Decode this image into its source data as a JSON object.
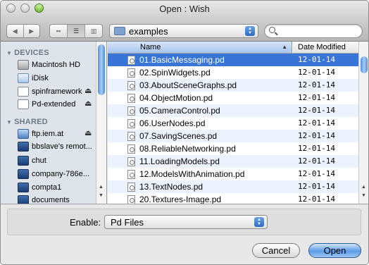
{
  "window": {
    "title": "Open : Wish"
  },
  "toolbar": {
    "back_glyph": "◀",
    "forward_glyph": "▶",
    "view_icons_glyph": "▪▪",
    "view_list_glyph": "☰",
    "view_columns_glyph": "▥",
    "path_folder": "examples",
    "search_placeholder": ""
  },
  "sidebar": {
    "devices_header": "DEVICES",
    "shared_header": "SHARED",
    "devices": [
      {
        "label": "Macintosh HD",
        "icon": "hard-drive-icon",
        "eject": ""
      },
      {
        "label": "iDisk",
        "icon": "idisk-icon",
        "eject": ""
      },
      {
        "label": "spinframework",
        "icon": "disk-image-icon",
        "eject": "⏏"
      },
      {
        "label": "Pd-extended",
        "icon": "disk-image-icon",
        "eject": "⏏"
      }
    ],
    "shared": [
      {
        "label": "ftp.iem.at",
        "icon": "network-server-icon",
        "eject": "⏏"
      },
      {
        "label": "bbslave's remot...",
        "icon": "monitor-icon",
        "eject": ""
      },
      {
        "label": "chut",
        "icon": "monitor-icon",
        "eject": ""
      },
      {
        "label": "company-786e...",
        "icon": "monitor-icon",
        "eject": ""
      },
      {
        "label": "compta1",
        "icon": "monitor-icon",
        "eject": ""
      },
      {
        "label": "documents",
        "icon": "monitor-icon",
        "eject": ""
      }
    ]
  },
  "filelist": {
    "col_name": "Name",
    "col_date": "Date Modified",
    "sort_glyph": "▲",
    "files": [
      {
        "name": "01.BasicMessaging.pd",
        "date": "12-01-14",
        "selected": true
      },
      {
        "name": "02.SpinWidgets.pd",
        "date": "12-01-14"
      },
      {
        "name": "03.AboutSceneGraphs.pd",
        "date": "12-01-14"
      },
      {
        "name": "04.ObjectMotion.pd",
        "date": "12-01-14"
      },
      {
        "name": "05.CameraControl.pd",
        "date": "12-01-14"
      },
      {
        "name": "06.UserNodes.pd",
        "date": "12-01-14"
      },
      {
        "name": "07.SavingScenes.pd",
        "date": "12-01-14"
      },
      {
        "name": "08.ReliableNetworking.pd",
        "date": "12-01-14"
      },
      {
        "name": "11.LoadingModels.pd",
        "date": "12-01-14"
      },
      {
        "name": "12.ModelsWithAnimation.pd",
        "date": "12-01-14"
      },
      {
        "name": "13.TextNodes.pd",
        "date": "12-01-14"
      },
      {
        "name": "20.Textures-Image.pd",
        "date": "12-01-14"
      }
    ]
  },
  "footer": {
    "enable_label": "Enable:",
    "enable_value": "Pd Files",
    "cancel_label": "Cancel",
    "open_label": "Open"
  },
  "colors": {
    "selection": "#3875d7",
    "sidebar_bg": "#dee4ea",
    "alt_row": "#edf3fe"
  }
}
